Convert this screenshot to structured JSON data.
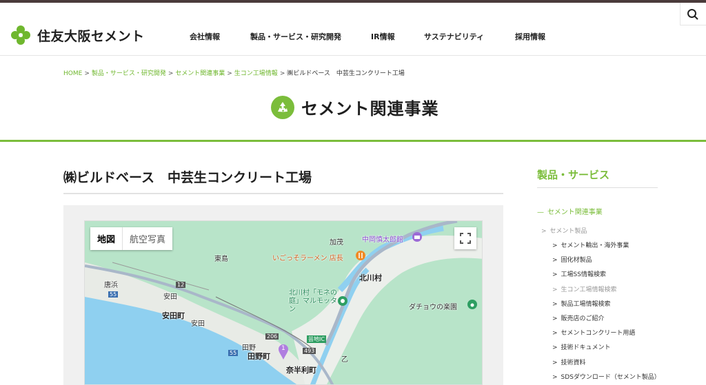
{
  "header": {
    "logo_text": "住友大阪セメント",
    "nav": [
      "会社情報",
      "製品・サービス・研究開発",
      "IR情報",
      "サステナビリティ",
      "採用情報"
    ]
  },
  "breadcrumb": [
    "HOME",
    "製品・サービス・研究開発",
    "セメント関連事業",
    "生コン工場情報",
    "㈱ビルドベース　中芸生コンクリート工場"
  ],
  "section": {
    "title": "セメント関連事業"
  },
  "page": {
    "title": "㈱ビルドベース　中芸生コンクリート工場"
  },
  "map": {
    "type_map": "地図",
    "type_satellite": "航空写真",
    "labels": {
      "kase": "加茂",
      "nakaoka": "中岡慎太郎館",
      "higashijima": "東島",
      "igosso": "いごっそラーメン 店長",
      "karahama": "唐浜",
      "yasuda_station": "安田",
      "kitagawa": "北川村",
      "monet": "北川村「モネの庭」マルモッタン",
      "dachou": "ダチョウの楽園",
      "yasuda_town": "安田町",
      "yasuda": "安田",
      "tano": "田野",
      "tano_town": "田野町",
      "geiic": "芸地IC",
      "otsu": "乙",
      "nahari": "奈半利町",
      "r12": "12",
      "r55a": "55",
      "r55b": "55",
      "r206": "206",
      "r493": "493",
      "pin": "1"
    }
  },
  "sidebar": {
    "title": "製品・サービス",
    "level1": "セメント関連事業",
    "level2": "セメント製品",
    "items": [
      "セメント輸出・海外事業",
      "固化材製品",
      "工場SS情報検索",
      "生コン工場情報検索",
      "製品工場情報検索",
      "販売店のご紹介",
      "セメントコンクリート用語",
      "技術ドキュメント",
      "技術資料",
      "SDSダウンロード（セメント製品）"
    ]
  },
  "colors": {
    "brand_green": "#7bbd3b",
    "topbar": "#4a3b3b"
  }
}
